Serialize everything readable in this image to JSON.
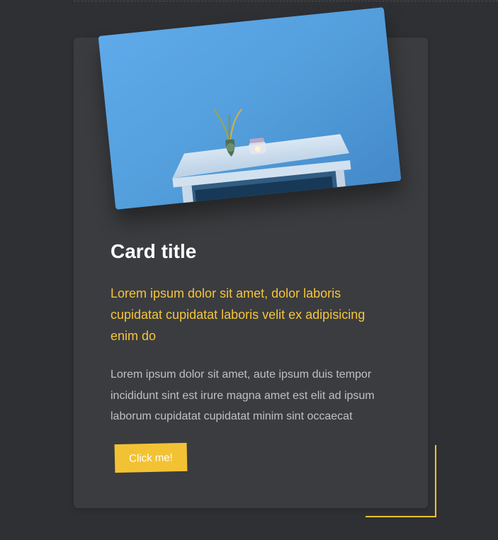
{
  "card": {
    "title": "Card title",
    "subtitle": "Lorem ipsum dolor sit amet, dolor laboris cupidatat cupidatat laboris velit ex adipisicing enim do",
    "body": "Lorem ipsum dolor sit amet, aute ipsum duis tempor incididunt sint est irure magna amet est elit ad ipsum laborum cupidatat cupidatat minim sint occaecat",
    "button_label": "Click me!"
  },
  "colors": {
    "background": "#2f3034",
    "card_background": "#3b3c3f",
    "accent": "#f3c234",
    "title": "#ffffff",
    "body_text": "#bfc0c2"
  }
}
